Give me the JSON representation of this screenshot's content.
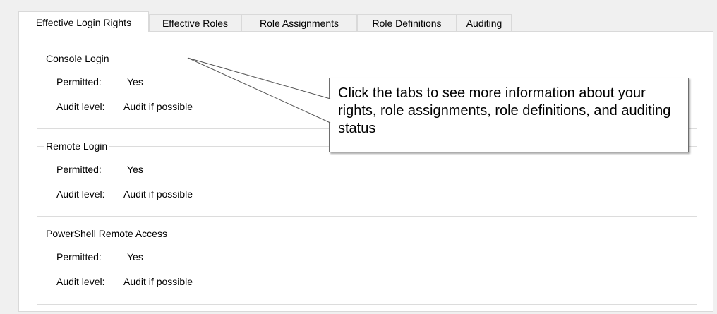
{
  "tabs": [
    {
      "label": "Effective Login Rights",
      "active": true
    },
    {
      "label": "Effective Roles",
      "active": false
    },
    {
      "label": "Role Assignments",
      "active": false
    },
    {
      "label": "Role Definitions",
      "active": false
    },
    {
      "label": "Auditing",
      "active": false
    }
  ],
  "groups": {
    "console": {
      "title": "Console Login",
      "permitted_label": "Permitted:",
      "permitted_value": "Yes",
      "audit_label": "Audit level:",
      "audit_value": "Audit if possible"
    },
    "remote": {
      "title": "Remote Login",
      "permitted_label": "Permitted:",
      "permitted_value": "Yes",
      "audit_label": "Audit level:",
      "audit_value": "Audit if possible"
    },
    "powershell": {
      "title": "PowerShell Remote Access",
      "permitted_label": "Permitted:",
      "permitted_value": "Yes",
      "audit_label": "Audit level:",
      "audit_value": "Audit if possible"
    }
  },
  "callout": {
    "text": "Click the tabs to see more information about your rights, role assignments, role definitions, and auditing status"
  },
  "colors": {
    "background": "#f0f0f0",
    "panel": "#ffffff",
    "border": "#d9d9d9",
    "callout_border": "#6e6e6e"
  }
}
